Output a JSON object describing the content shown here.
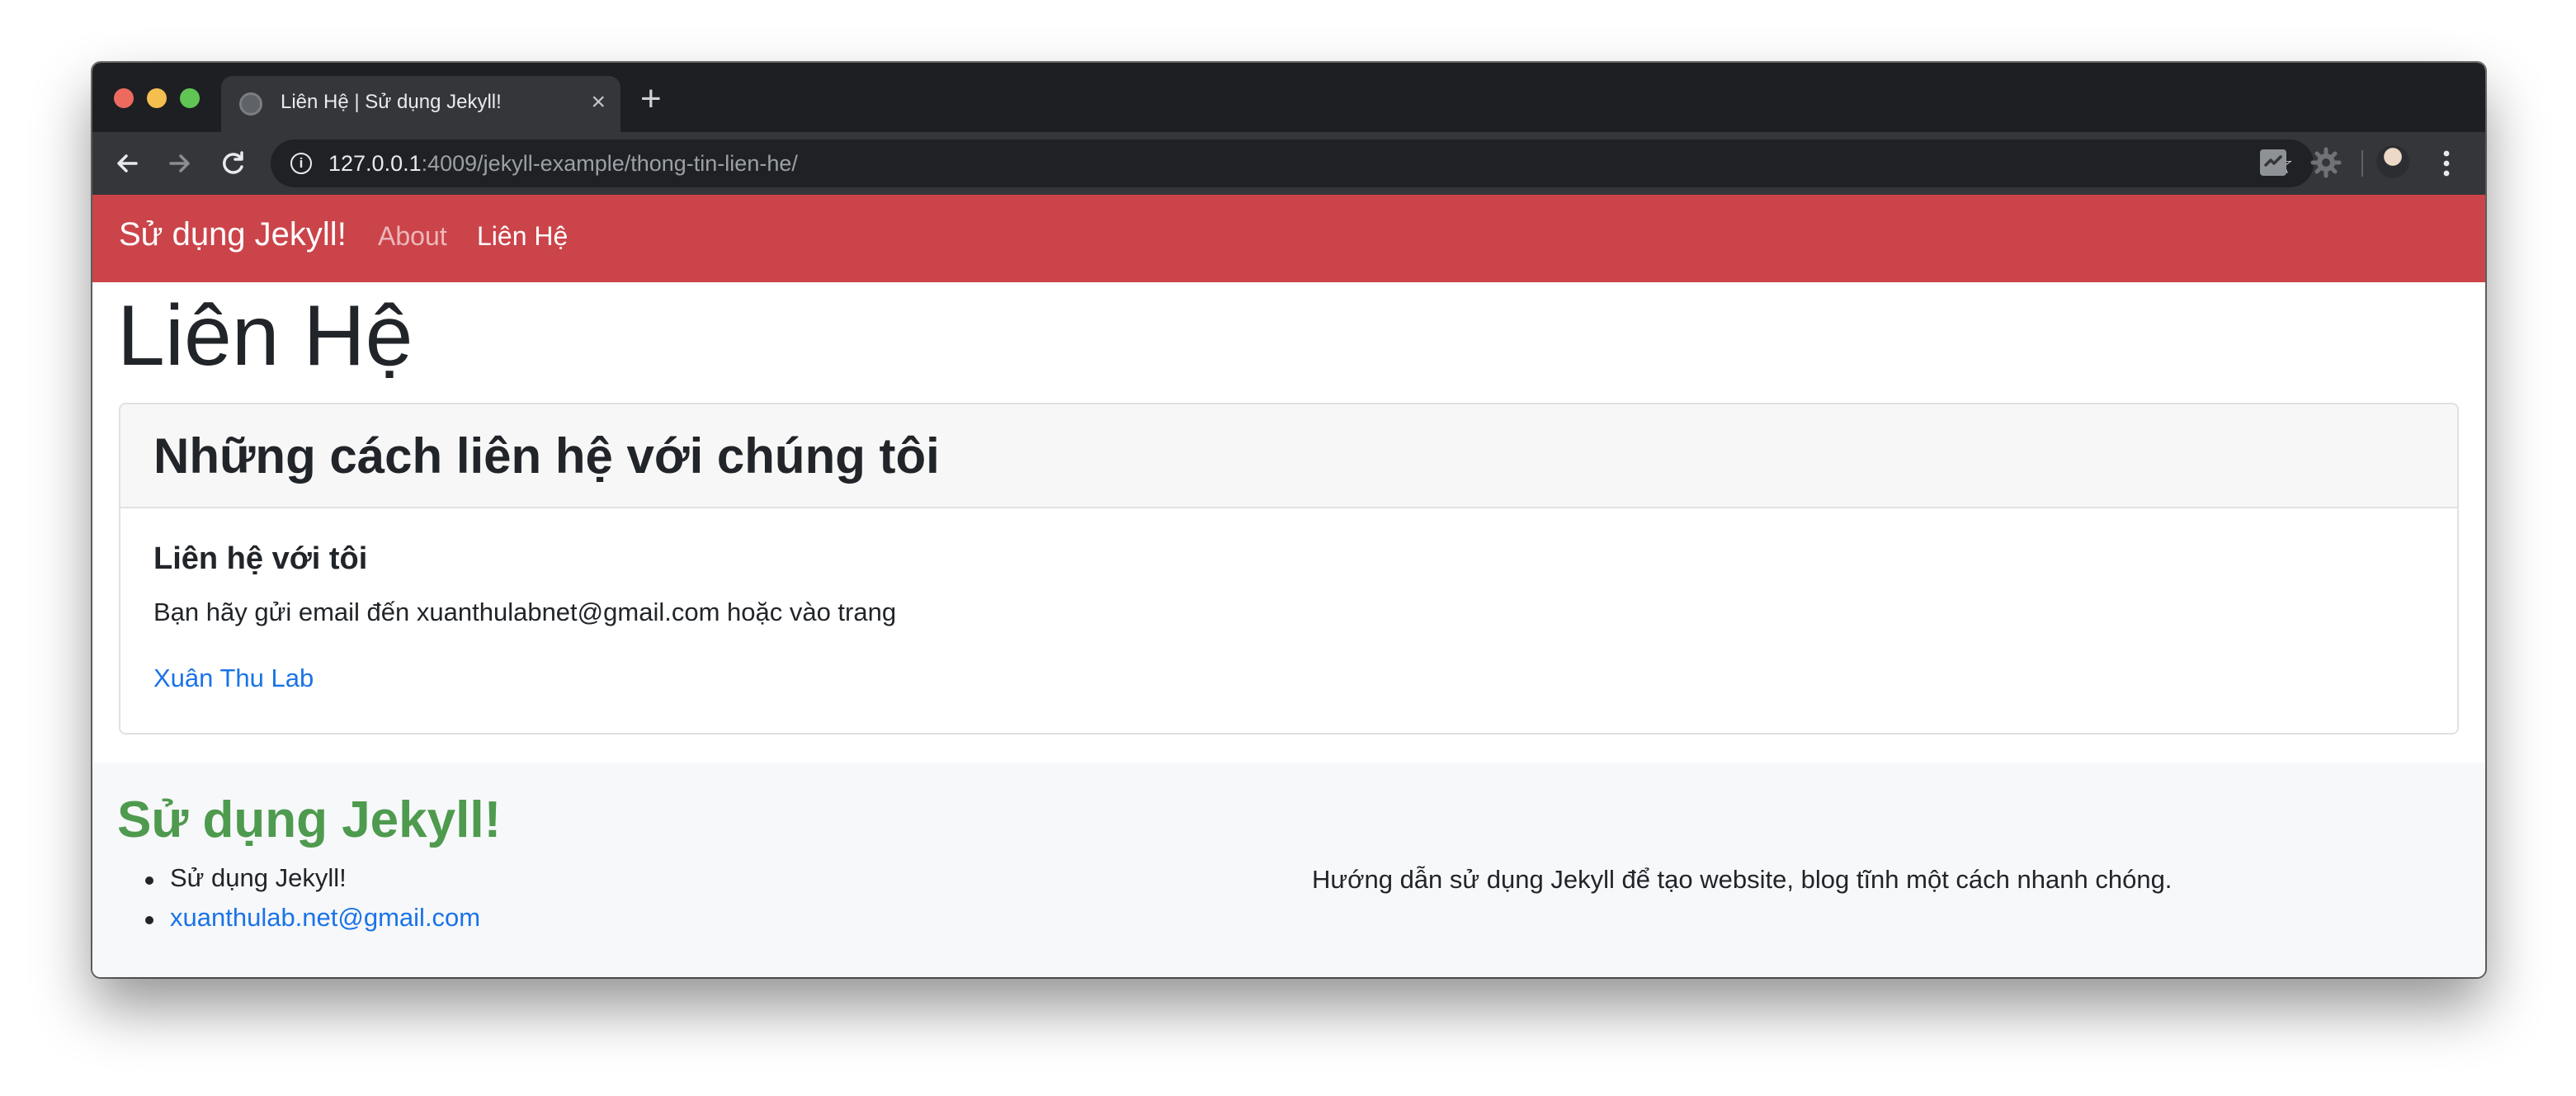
{
  "browser": {
    "tab": {
      "title": "Liên Hệ | Sử dụng Jekyll!",
      "close_glyph": "×",
      "favicon": "globe-icon"
    },
    "new_tab_glyph": "+",
    "address": {
      "host": "127.0.0.1",
      "path": ":4009/jekyll-example/thong-tin-lien-he/"
    },
    "info_glyph": "i",
    "bookmark_glyph": "☆",
    "icons": [
      "back-arrow-icon",
      "forward-arrow-icon",
      "reload-icon",
      "info-icon",
      "star-icon",
      "extension-icon",
      "gear-icon",
      "profile-avatar-icon",
      "menu-dots-icon"
    ],
    "colors": {
      "tabstrip": "#1e1f22",
      "toolbar": "#35363a",
      "omnibox": "#202124"
    }
  },
  "navbar": {
    "brand": "Sử dụng Jekyll!",
    "links": [
      "About",
      "Liên Hệ"
    ],
    "color": "#cb444a"
  },
  "page": {
    "title": "Liên Hệ",
    "card": {
      "header": "Những cách liên hệ với chúng tôi",
      "subtitle": "Liên hệ với tôi",
      "text": "Bạn hãy gửi email đến xuanthulabnet@gmail.com hoặc vào trang",
      "link": "Xuân Thu Lab"
    }
  },
  "footer": {
    "title": "Sử dụng Jekyll!",
    "items": [
      "Sử dụng Jekyll!",
      "xuanthulab.net@gmail.com"
    ],
    "description": "Hướng dẫn sử dụng Jekyll để tạo website, blog tĩnh một cách nhanh chóng.",
    "title_color": "#4e9a4e",
    "link_color": "#1a73e8"
  }
}
